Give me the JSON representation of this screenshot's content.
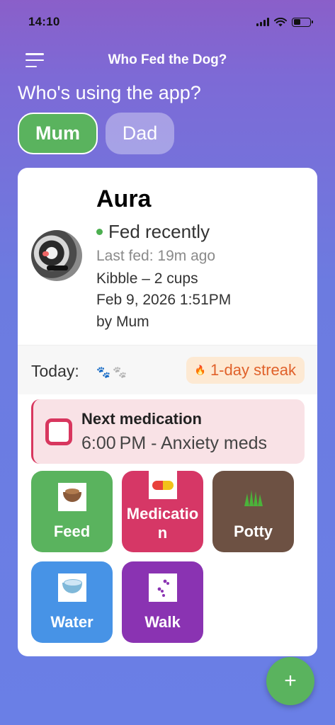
{
  "status_bar": {
    "time": "14:10"
  },
  "header": {
    "title": "Who Fed the Dog?"
  },
  "user_select": {
    "prompt": "Who's using the app?",
    "users": [
      {
        "label": "Mum",
        "selected": true
      },
      {
        "label": "Dad",
        "selected": false
      }
    ]
  },
  "pet": {
    "name": "Aura",
    "status": "Fed recently",
    "status_color": "#4caf50",
    "last_fed": "Last fed: 19m ago",
    "food": "Kibble – 2 cups",
    "datetime": "Feb 9, 2026 1:51PM",
    "by": "by Mum"
  },
  "today": {
    "label": "Today:",
    "paws_fed": 1,
    "paws_total": 2,
    "streak": "1-day streak",
    "streak_icon": "flame-icon"
  },
  "medication": {
    "title": "Next medication",
    "detail": "6:00 PM - Anxiety meds",
    "accent": "#d8365e"
  },
  "actions": [
    {
      "label": "Feed",
      "icon": "food-bowl-icon",
      "color": "#5ab35e"
    },
    {
      "label": "Medication",
      "icon": "pill-icon",
      "color": "#d63766"
    },
    {
      "label": "Potty",
      "icon": "grass-icon",
      "color": "#6d5143"
    },
    {
      "label": "Water",
      "icon": "water-bowl-icon",
      "color": "#4793e6"
    },
    {
      "label": "Walk",
      "icon": "paw-prints-icon",
      "color": "#8a33b2"
    }
  ],
  "fab": {
    "label": "+"
  }
}
